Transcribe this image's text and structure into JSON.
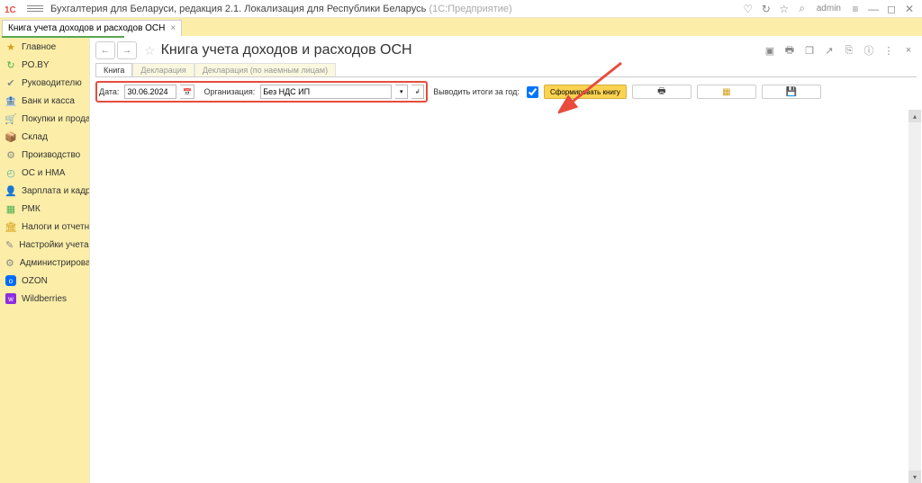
{
  "titlebar": {
    "app_title": "Бухгалтерия для Беларуси, редакция 2.1. Локализация для Республики Беларусь",
    "mode_suffix": "(1С:Предприятие)",
    "user": "admin"
  },
  "page_tab": {
    "label": "Книга учета доходов и расходов ОСН"
  },
  "sidebar": {
    "items": [
      {
        "icon": "★",
        "cls": "c-gold",
        "label": "Главное"
      },
      {
        "icon": "↻",
        "cls": "c-green",
        "label": "PO.BY"
      },
      {
        "icon": "✔",
        "cls": "c-gray",
        "label": "Руководителю"
      },
      {
        "icon": "🏦",
        "cls": "c-gold",
        "label": "Банк и касса"
      },
      {
        "icon": "🛒",
        "cls": "c-green",
        "label": "Покупки и продажи"
      },
      {
        "icon": "📦",
        "cls": "c-gold",
        "label": "Склад"
      },
      {
        "icon": "⚙",
        "cls": "c-gray",
        "label": "Производство"
      },
      {
        "icon": "◴",
        "cls": "c-teal",
        "label": "ОС и НМА"
      },
      {
        "icon": "👤",
        "cls": "c-blue",
        "label": "Зарплата и кадры"
      },
      {
        "icon": "▦",
        "cls": "c-green",
        "label": "РМК"
      },
      {
        "icon": "🏛",
        "cls": "c-gold",
        "label": "Налоги и отчетность"
      },
      {
        "icon": "✎",
        "cls": "c-gray",
        "label": "Настройки учета"
      },
      {
        "icon": "⚙",
        "cls": "c-gray",
        "label": "Администрирование"
      },
      {
        "icon": "o",
        "cls": "c-ozon",
        "label": "OZON"
      },
      {
        "icon": "w",
        "cls": "c-wb",
        "label": "Wildberries"
      }
    ]
  },
  "main": {
    "title": "Книга учета доходов и расходов ОСН",
    "tabs": [
      {
        "label": "Книга",
        "active": true
      },
      {
        "label": "Декларация",
        "active": false
      },
      {
        "label": "Декларация (по наемным лицам)",
        "active": false
      }
    ],
    "toolbar": {
      "date_label": "Дата:",
      "date_value": "30.06.2024",
      "org_label": "Организация:",
      "org_value": "Без НДС ИП",
      "yearly_label": "Выводить итоги за год:",
      "yearly_checked": true,
      "form_button": "Сформировать книгу"
    }
  }
}
